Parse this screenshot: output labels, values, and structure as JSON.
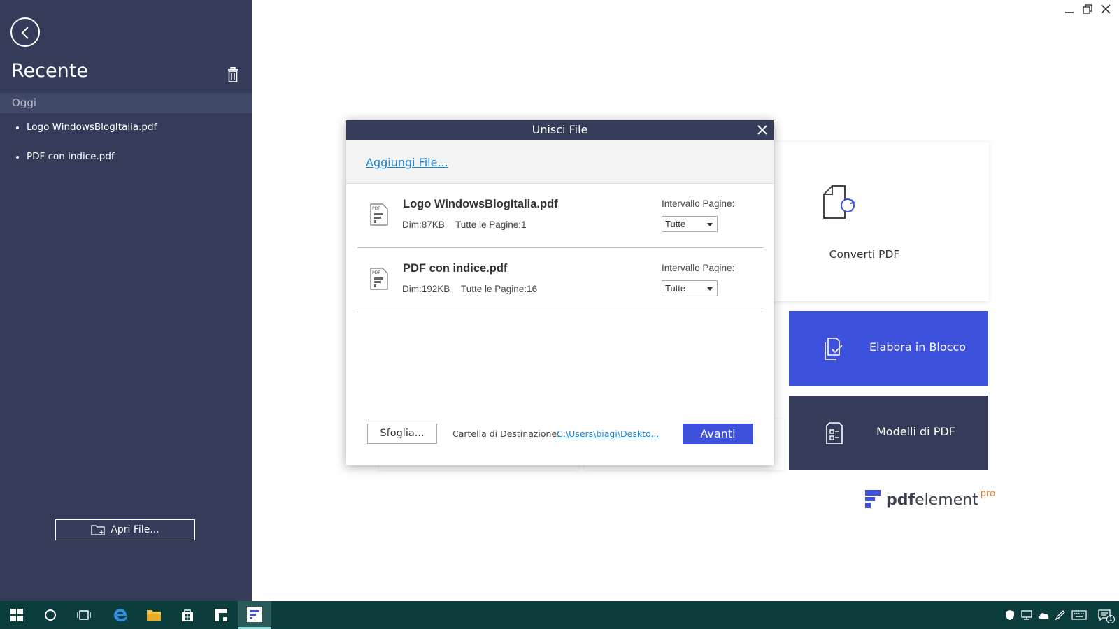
{
  "sidebar": {
    "title": "Recente",
    "group_label": "Oggi",
    "items": [
      {
        "label": "Logo WindowsBlogItalia.pdf"
      },
      {
        "label": "PDF con indice.pdf"
      }
    ],
    "open_file_label": "Apri File..."
  },
  "home": {
    "convert_label": "Converti PDF",
    "batch_label": "Elabora in Blocco",
    "templates_label": "Modelli di PDF",
    "brand": {
      "bold": "pdf",
      "regular": "element",
      "suffix": "pro"
    }
  },
  "dialog": {
    "title": "Unisci File",
    "add_files_label": "Aggiungi File...",
    "files": [
      {
        "name": "Logo WindowsBlogItalia.pdf",
        "size": "Dim:87KB",
        "pages": "Tutte le Pagine:1",
        "range_label": "Intervallo Pagine:",
        "range_value": "Tutte"
      },
      {
        "name": "PDF con indice.pdf",
        "size": "Dim:192KB",
        "pages": "Tutte le Pagine:16",
        "range_label": "Intervallo Pagine:",
        "range_value": "Tutte"
      }
    ],
    "browse_label": "Sfoglia...",
    "dest_label": "Cartella di Destinazione:",
    "dest_path": "C:\\Users\\biagi\\Deskto...",
    "next_label": "Avanti"
  },
  "colors": {
    "sidebar_bg": "#353c5a",
    "accent": "#3e51dc",
    "link": "#1a86d6",
    "taskbar": "#0c3d3d"
  },
  "taskbar": {
    "icons": [
      "windows-start-icon",
      "cortana-icon",
      "task-view-icon",
      "edge-icon",
      "file-explorer-icon",
      "store-icon",
      "flipboard-icon",
      "pdfelement-icon"
    ],
    "tray_icons": [
      "defender-icon",
      "network-icon",
      "onedrive-icon",
      "pen-icon",
      "keyboard-icon",
      "notifications-icon"
    ],
    "notification_count": "1"
  }
}
